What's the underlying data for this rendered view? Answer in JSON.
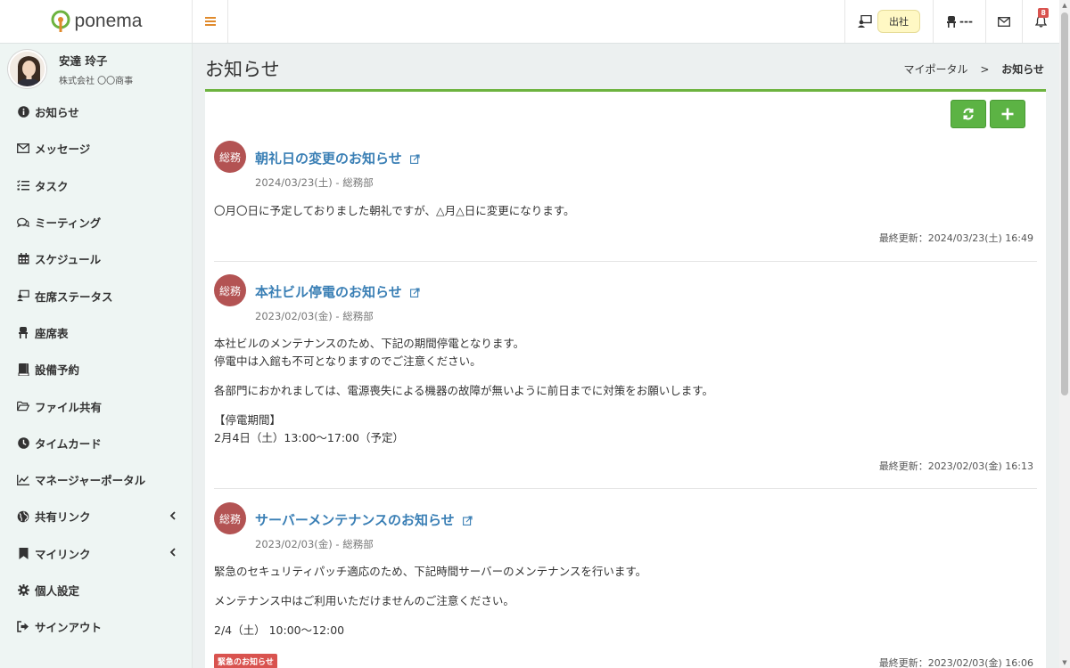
{
  "header": {
    "logo_text": "ponema",
    "status_label": "出社",
    "seat_label": "---",
    "notification_count": "8"
  },
  "user": {
    "name": "安達 玲子",
    "company": "株式会社 〇〇商事"
  },
  "nav": {
    "items": [
      {
        "label": "お知らせ",
        "icon": "info-icon"
      },
      {
        "label": "メッセージ",
        "icon": "envelope-icon"
      },
      {
        "label": "タスク",
        "icon": "task-list-icon"
      },
      {
        "label": "ミーティング",
        "icon": "chat-bubbles-icon"
      },
      {
        "label": "スケジュール",
        "icon": "calendar-icon"
      },
      {
        "label": "在席ステータス",
        "icon": "presence-icon"
      },
      {
        "label": "座席表",
        "icon": "chair-icon"
      },
      {
        "label": "設備予約",
        "icon": "book-icon"
      },
      {
        "label": "ファイル共有",
        "icon": "folder-icon"
      },
      {
        "label": "タイムカード",
        "icon": "clock-icon"
      },
      {
        "label": "マネージャーポータル",
        "icon": "chart-icon"
      },
      {
        "label": "共有リンク",
        "icon": "globe-icon"
      },
      {
        "label": "マイリンク",
        "icon": "bookmark-icon"
      },
      {
        "label": "個人設定",
        "icon": "gear-icon"
      },
      {
        "label": "サインアウト",
        "icon": "sign-out-icon"
      }
    ]
  },
  "page": {
    "title": "お知らせ",
    "breadcrumb_parent": "マイポータル",
    "breadcrumb_sep": ">",
    "breadcrumb_current": "お知らせ"
  },
  "notices": [
    {
      "dept": "総務",
      "title": "朝礼日の変更のお知らせ",
      "meta": "2024/03/23(土) - 総務部",
      "paragraphs": [
        "〇月〇日に予定しておりました朝礼ですが、△月△日に変更になります。"
      ],
      "updated": "最終更新：2024/03/23(土) 16:49"
    },
    {
      "dept": "総務",
      "title": "本社ビル停電のお知らせ",
      "meta": "2023/02/03(金) - 総務部",
      "paragraphs": [
        "本社ビルのメンテナンスのため、下記の期間停電となります。",
        "停電中は入館も不可となりますのでご注意ください。",
        "各部門におかれましては、電源喪失による機器の故障が無いように前日までに対策をお願いします。",
        "【停電期間】",
        "2月4日（土）13:00〜17:00（予定）"
      ],
      "updated": "最終更新：2023/02/03(金) 16:13"
    },
    {
      "dept": "総務",
      "title": "サーバーメンテナンスのお知らせ",
      "meta": "2023/02/03(金) - 総務部",
      "paragraphs": [
        "緊急のセキュリティパッチ適応のため、下記時間サーバーのメンテナンスを行います。",
        "メンテナンス中はご利用いただけませんのご注意ください。",
        "2/4（土） 10:00〜12:00"
      ],
      "urgent_badge": "緊急のお知らせ",
      "updated": "最終更新：2023/02/03(金) 16:06"
    }
  ],
  "colors": {
    "accent_green": "#6db33f",
    "button_green": "#5cb344",
    "dept_red": "#b35353",
    "link_blue": "#3a7fb5",
    "urgent_red": "#d9534f",
    "status_yellow": "#fff8c4"
  }
}
